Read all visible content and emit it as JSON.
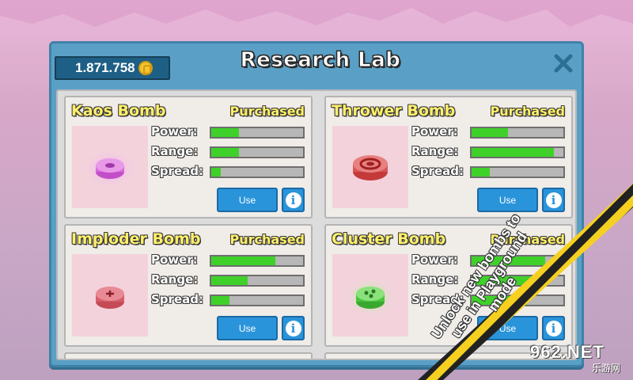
{
  "header": {
    "coins": "1.871.758",
    "coin_icon": "coin-icon",
    "title": "Research Lab",
    "close_icon": "close-icon"
  },
  "stat_labels": {
    "power": "Power:",
    "range": "Range:",
    "spread": "Spread:"
  },
  "bombs": [
    {
      "name": "Kaos Bomb",
      "status": "Purchased",
      "power": 0.3,
      "range": 0.3,
      "spread": 0.1,
      "use_label": "Use",
      "color": "#c060d0"
    },
    {
      "name": "Thrower Bomb",
      "status": "Purchased",
      "power": 0.4,
      "range": 0.9,
      "spread": 0.2,
      "use_label": "Use",
      "color": "#d85050"
    },
    {
      "name": "Imploder Bomb",
      "status": "Purchased",
      "power": 0.7,
      "range": 0.4,
      "spread": 0.2,
      "use_label": "Use",
      "color": "#d85868"
    },
    {
      "name": "Cluster Bomb",
      "status": "Purchased",
      "power": 0.8,
      "range": 0.7,
      "spread": 0.6,
      "use_label": "Use",
      "color": "#60d850"
    }
  ],
  "promo": {
    "text": "Unlock new bombs to use in Playground mode"
  },
  "watermark": {
    "main": "962.NET",
    "sub": "乐游网"
  },
  "colors": {
    "panel": "#5aa0c6",
    "bar_fill": "#3fd12a",
    "button": "#2a94da",
    "title_yellow": "#fff06a"
  }
}
